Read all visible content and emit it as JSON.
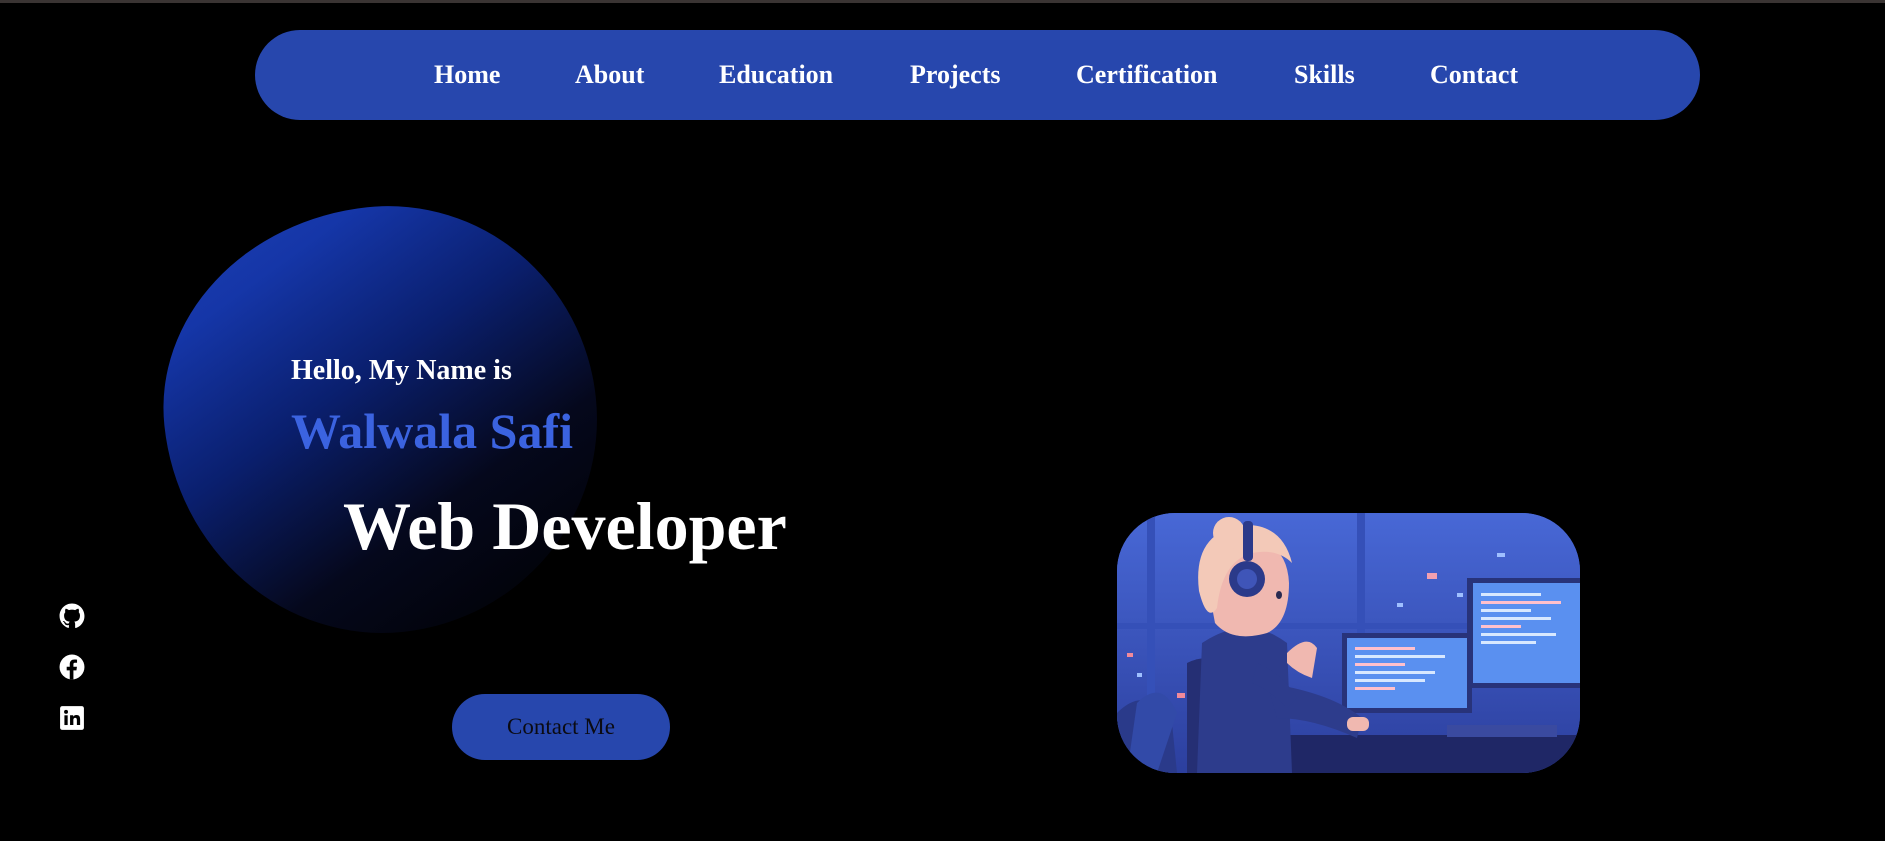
{
  "nav": {
    "items": [
      {
        "label": "Home"
      },
      {
        "label": "About"
      },
      {
        "label": "Education"
      },
      {
        "label": "Projects"
      },
      {
        "label": "Certification"
      },
      {
        "label": "Skills"
      },
      {
        "label": "Contact"
      }
    ]
  },
  "hero": {
    "greeting": "Hello, My Name is",
    "name": "Walwala Safi",
    "role": "Web Developer",
    "contact_button": "Contact Me"
  },
  "social": [
    {
      "icon": "github-icon"
    },
    {
      "icon": "facebook-icon"
    },
    {
      "icon": "linkedin-icon"
    }
  ],
  "illustration": {
    "subject": "girl-with-headphones-coding-illustration"
  },
  "colors": {
    "background": "#000000",
    "accent": "#2747ad",
    "name_text": "#3b63e0",
    "text": "#ffffff"
  }
}
